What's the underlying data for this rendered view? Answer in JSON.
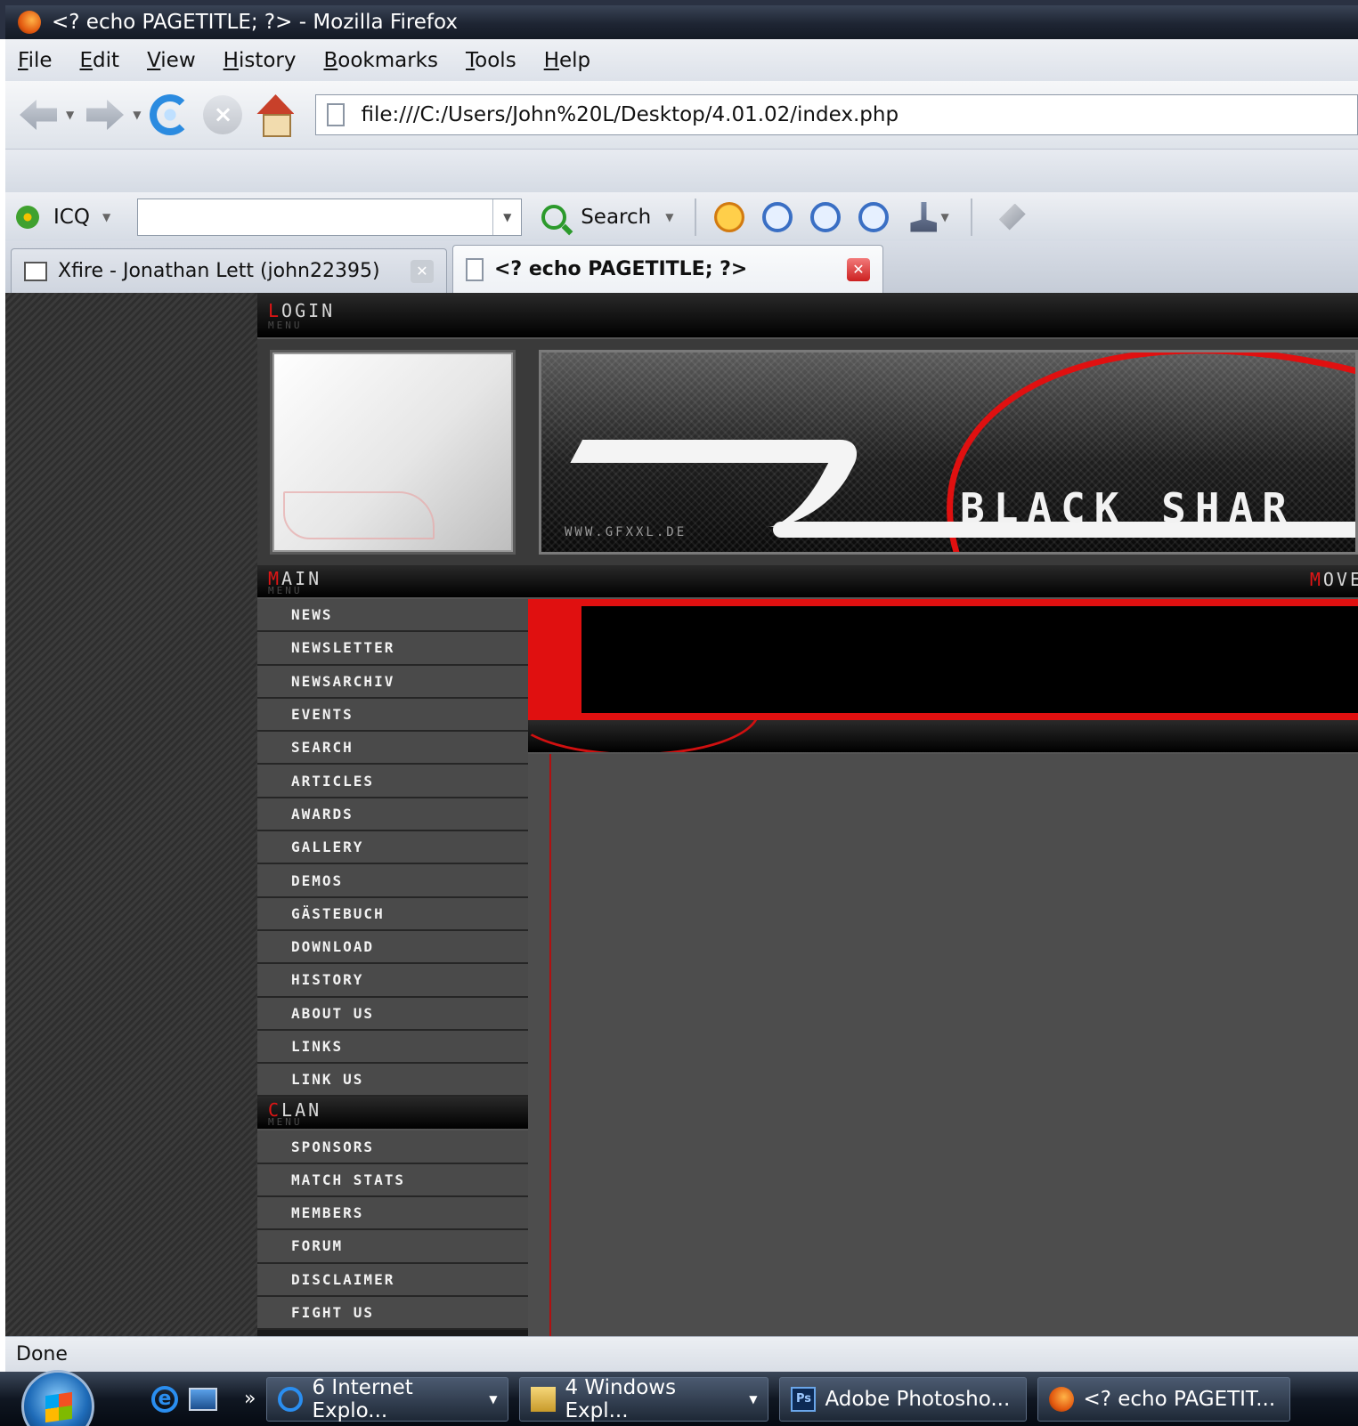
{
  "window": {
    "title": "<? echo PAGETITLE; ?> - Mozilla Firefox"
  },
  "menubar": {
    "items": [
      "File",
      "Edit",
      "View",
      "History",
      "Bookmarks",
      "Tools",
      "Help"
    ]
  },
  "navbar": {
    "url": "file:///C:/Users/John%20L/Desktop/4.01.02/index.php"
  },
  "icqbar": {
    "label": "ICQ",
    "search_label": "Search",
    "input_value": ""
  },
  "tabs": [
    {
      "title": "Xfire - Jonathan Lett (john22395)",
      "active": false
    },
    {
      "title": "<? echo PAGETITLE; ?>",
      "active": true
    }
  ],
  "site": {
    "login_header": "Login",
    "login_sub": "Menu",
    "main_header": "Main",
    "main_sub": "Menu",
    "main_menu": [
      "NEWS",
      "NEWSLETTER",
      "NEWSARCHIV",
      "EVENTS",
      "SEARCH",
      "ARTICLES",
      "AWARDS",
      "GALLERY",
      "DEMOS",
      "GÄSTEBUCH",
      "DOWNLOAD",
      "HISTORY",
      "ABOUT US",
      "LINKS",
      "LINK US"
    ],
    "clan_header": "Clan",
    "clan_sub": "Menu",
    "clan_menu": [
      "SPONSORS",
      "MATCH STATS",
      "MEMBERS",
      "FORUM",
      "DISCLAIMER",
      "FIGHT US"
    ],
    "banner_title": "BLACK SHAR",
    "banner_url": "WWW.GFXXL.DE",
    "news_header": "Move"
  },
  "statusbar": {
    "text": "Done"
  },
  "taskbar": {
    "buttons": [
      {
        "label": "6 Internet Explo...",
        "icon": "ie-icon",
        "grouped": true
      },
      {
        "label": "4 Windows Expl...",
        "icon": "folder-icon",
        "grouped": true
      },
      {
        "label": "Adobe Photosho...",
        "icon": "photoshop-icon",
        "grouped": false
      },
      {
        "label": "<? echo PAGETIT...",
        "icon": "firefox-icon",
        "grouped": false
      }
    ]
  },
  "colors": {
    "accent_red": "#e01010",
    "sidebar_item_bg": "#4a4a4a",
    "content_bg": "#4d4d4d"
  }
}
